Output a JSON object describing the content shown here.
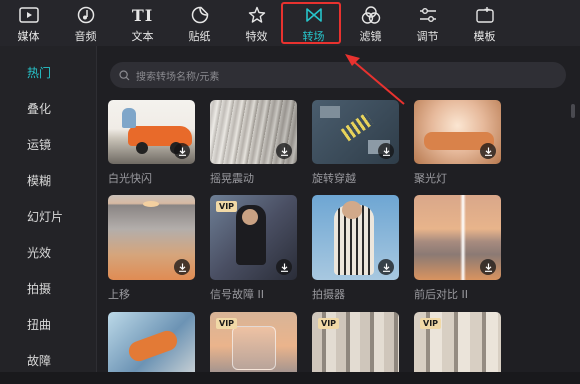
{
  "toolbar": {
    "items": [
      {
        "label": "媒体",
        "icon": "media-icon"
      },
      {
        "label": "音频",
        "icon": "audio-icon"
      },
      {
        "label": "文本",
        "icon": "text-icon"
      },
      {
        "label": "贴纸",
        "icon": "sticker-icon"
      },
      {
        "label": "特效",
        "icon": "effects-icon"
      },
      {
        "label": "转场",
        "icon": "transition-icon",
        "active": true
      },
      {
        "label": "滤镜",
        "icon": "filter-icon"
      },
      {
        "label": "调节",
        "icon": "adjust-icon"
      },
      {
        "label": "模板",
        "icon": "template-icon"
      }
    ],
    "text_icon_glyph": "TI"
  },
  "sidebar": {
    "items": [
      {
        "label": "热门",
        "active": true
      },
      {
        "label": "叠化"
      },
      {
        "label": "运镜"
      },
      {
        "label": "模糊"
      },
      {
        "label": "幻灯片"
      },
      {
        "label": "光效"
      },
      {
        "label": "拍摄"
      },
      {
        "label": "扭曲"
      },
      {
        "label": "故障"
      }
    ]
  },
  "search": {
    "placeholder": "搜索转场名称/元素"
  },
  "grid": {
    "items": [
      {
        "name": "白光快闪",
        "vip": false,
        "download": true
      },
      {
        "name": "摇晃震动",
        "vip": false,
        "download": true
      },
      {
        "name": "旋转穿越",
        "vip": false,
        "download": true
      },
      {
        "name": "聚光灯",
        "vip": false,
        "download": true
      },
      {
        "name": "上移",
        "vip": false,
        "download": true
      },
      {
        "name": "信号故障 II",
        "vip": true,
        "download": true
      },
      {
        "name": "拍摄器",
        "vip": false,
        "download": true
      },
      {
        "name": "前后对比 II",
        "vip": false,
        "download": true
      },
      {
        "name": "",
        "vip": false,
        "download": false
      },
      {
        "name": "",
        "vip": true,
        "download": false
      },
      {
        "name": "",
        "vip": true,
        "download": false
      },
      {
        "name": "",
        "vip": true,
        "download": false
      }
    ],
    "vip_label": "VIP"
  },
  "colors": {
    "accent": "#27c4ca",
    "highlight_box": "#e8322f",
    "background": "#1f1f23"
  }
}
